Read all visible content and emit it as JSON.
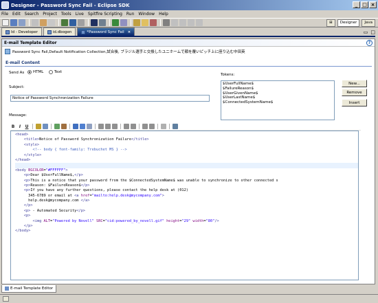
{
  "window": {
    "title": "Designer - Password Sync Fail - Eclipse SDK"
  },
  "menu": [
    "File",
    "Edit",
    "Search",
    "Project",
    "Tools",
    "Live",
    "Spitfire Scripting",
    "Run",
    "Window",
    "Help"
  ],
  "perspectives": {
    "designer": "Designer",
    "java": "Java"
  },
  "tabs": [
    {
      "label": "Id - Developer"
    },
    {
      "label": "id.dbogen"
    },
    {
      "label": "*Password Sync Fail"
    }
  ],
  "editor": {
    "header": "E-mail Template Editor",
    "path": "Password Sync Fail,Default Notification Collection,試合後, ブラジル選手と交換したユニホームで顔を覆いピッチ上に座り込む中田英",
    "section": "E-mail Content",
    "send_as_label": "Send As",
    "send_as_options": [
      "HTML",
      "Text"
    ],
    "send_as_selected": "HTML",
    "subject_label": "Subject:",
    "subject_value": "Notice of Password Synchronization Failure",
    "tokens_label": "Tokens:",
    "tokens": [
      "$UserFullName$",
      "$FailureReason$",
      "$UserGivenName$",
      "$UserLastName$",
      "$ConnectedSystemName$"
    ],
    "buttons": {
      "new": "New...",
      "remove": "Remove",
      "insert": "Insert"
    },
    "message_label": "Message:",
    "format_bold": "B",
    "format_italic": "I",
    "format_underline": "U"
  },
  "code_lines": [
    "<head>",
    "    <title>Notice of Password Synchronization Failure</title>",
    "    <style>",
    "        <!-- body { font-family: Trebuchet MS } -->",
    "    </style>",
    "</head>",
    "",
    "<body BGCOLOR=\"#FFFFFF\">",
    "    <p>Dear $UserFullName$,</p>",
    "    <p>This is a notice that your password from the $ConnectedSystemName$ was unable to synchronize to other connected s",
    "    <p>Reason: $FailureReason$</p>",
    "    <p>If you have any further questions, please contact the help desk at (012)",
    "      345-6789 or email at <a href=\"mailto:help.desk@mycompany.com\">",
    "      help.desk@mycompany.com </a>",
    "    </p>",
    "    <p> - Automated Security</p>",
    "    <p>",
    "        <img ALT=\"Powered by Novell\" SRC=\"cid:powered_by_novell.gif\" height=\"29\" width=\"80\"/>",
    "    </p>",
    "</body>"
  ],
  "bottom_tab": "E-mail Template Editor"
}
